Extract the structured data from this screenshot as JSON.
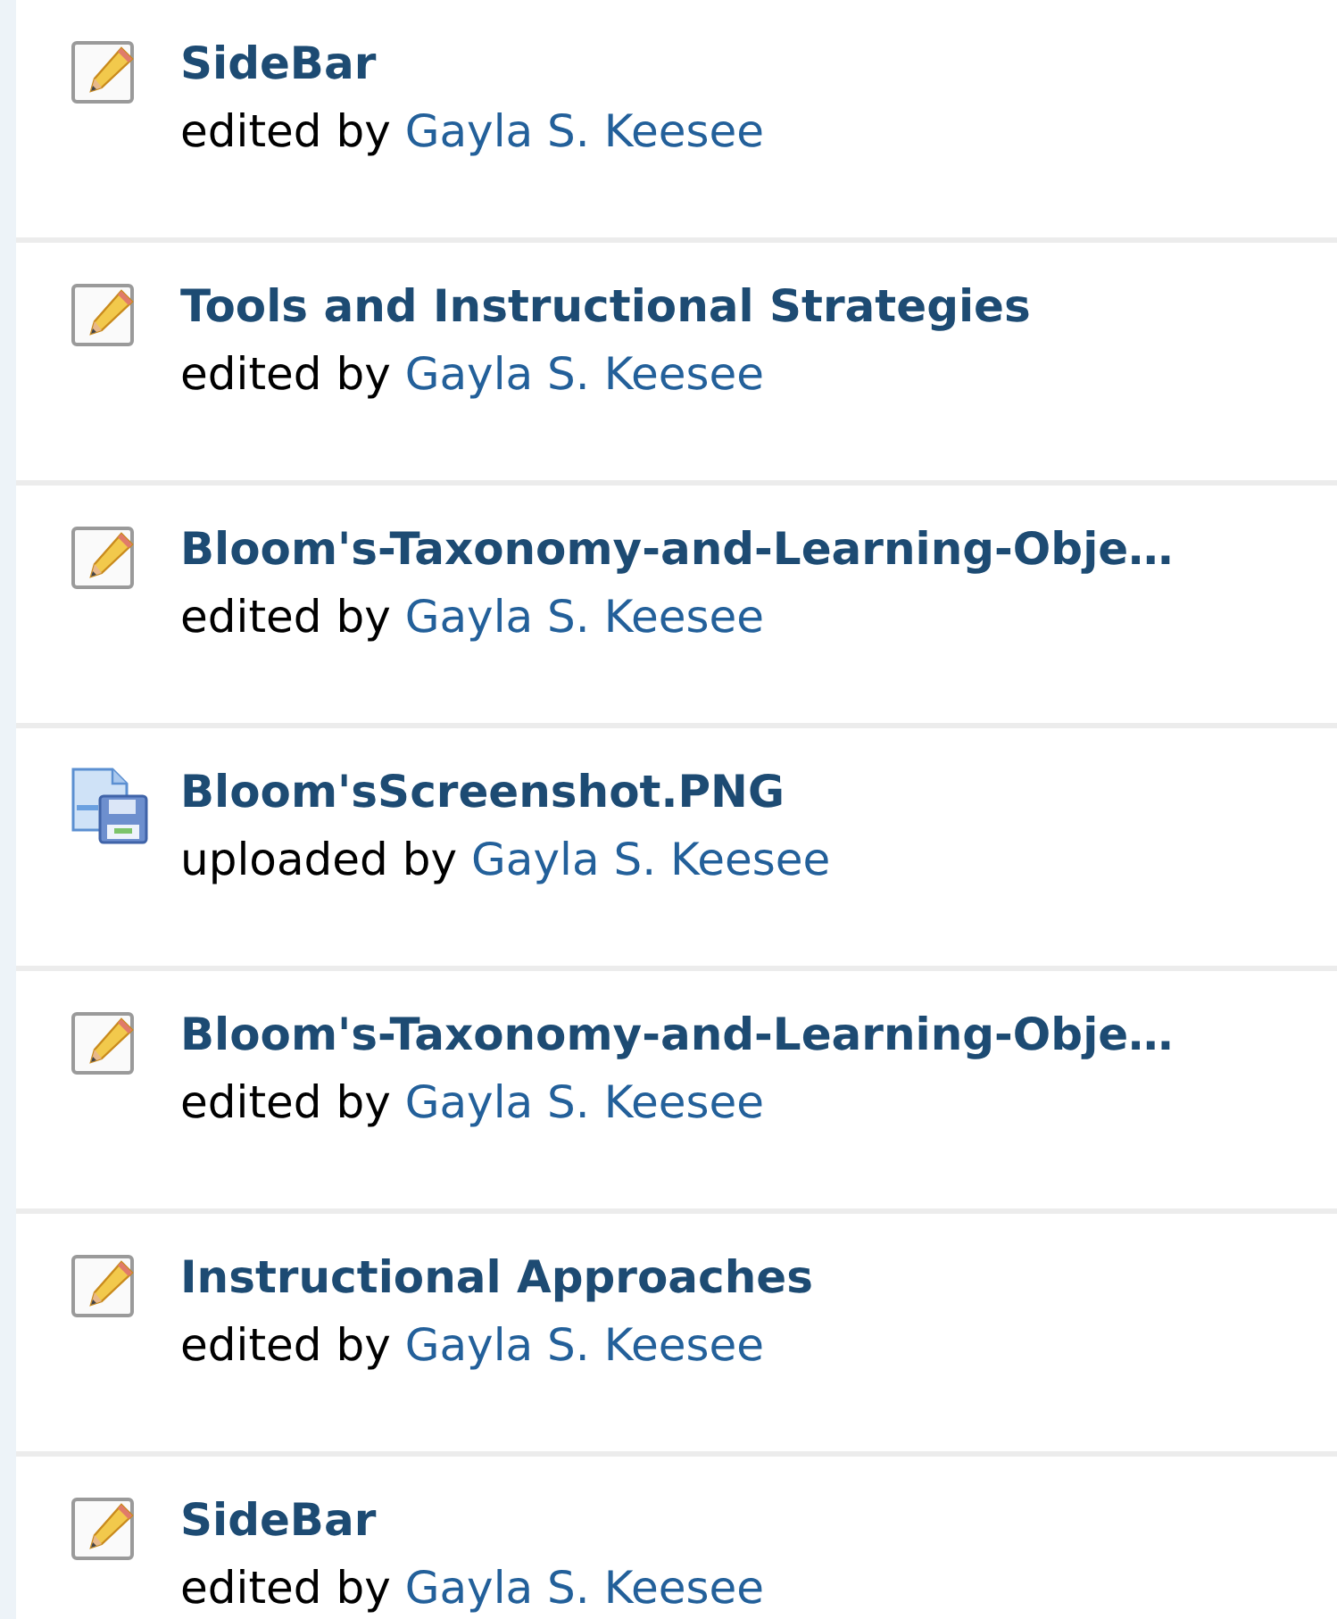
{
  "activity": [
    {
      "kind": "edit",
      "title": "SideBar",
      "action": "edited by",
      "author": "Gayla S. Keesee"
    },
    {
      "kind": "edit",
      "title": "Tools and Instructional Strategies",
      "action": "edited by",
      "author": "Gayla S. Keesee"
    },
    {
      "kind": "edit",
      "title": "Bloom's-Taxonomy-and-Learning-Obje…",
      "action": "edited by",
      "author": "Gayla S. Keesee"
    },
    {
      "kind": "upload",
      "title": "Bloom'sScreenshot.PNG",
      "action": "uploaded by",
      "author": "Gayla S. Keesee"
    },
    {
      "kind": "edit",
      "title": "Bloom's-Taxonomy-and-Learning-Obje…",
      "action": "edited by",
      "author": "Gayla S. Keesee"
    },
    {
      "kind": "edit",
      "title": "Instructional Approaches",
      "action": "edited by",
      "author": "Gayla S. Keesee"
    },
    {
      "kind": "edit",
      "title": "SideBar",
      "action": "edited by",
      "author": "Gayla S. Keesee"
    }
  ]
}
